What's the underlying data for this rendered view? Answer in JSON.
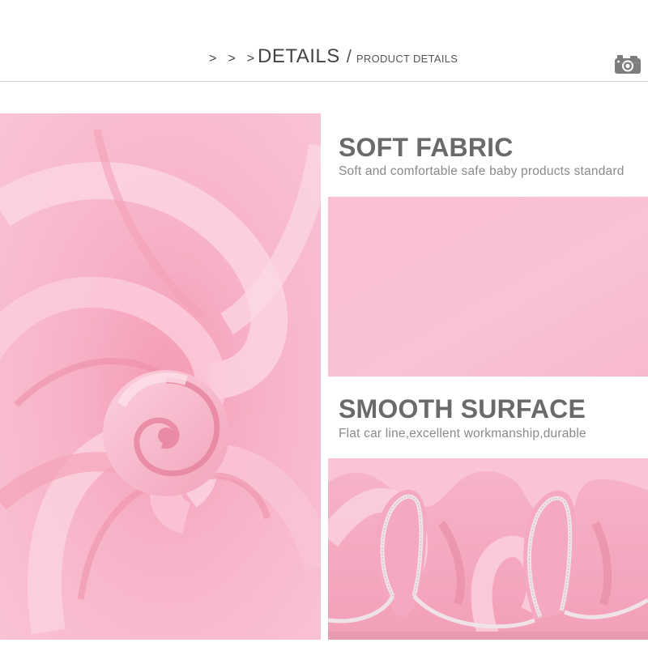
{
  "header": {
    "chevrons": [
      ">",
      ">",
      ">"
    ],
    "title": "DETAILS",
    "separator": "/",
    "subtitle": "PRODUCT DETAILS",
    "icon": "camera-icon"
  },
  "features": [
    {
      "title": "SOFT FABRIC",
      "description": "Soft and comfortable safe baby products standard"
    },
    {
      "title": "SMOOTH SURFACE",
      "description": "Flat car line,excellent workmanship,durable"
    }
  ],
  "colors": {
    "fabric_pink": "#f6b6cc",
    "fabric_light": "#fac7d8",
    "fabric_shadow": "#e4889f",
    "heading_gray": "#6a6a6a",
    "text_gray": "#8a8a8a"
  }
}
